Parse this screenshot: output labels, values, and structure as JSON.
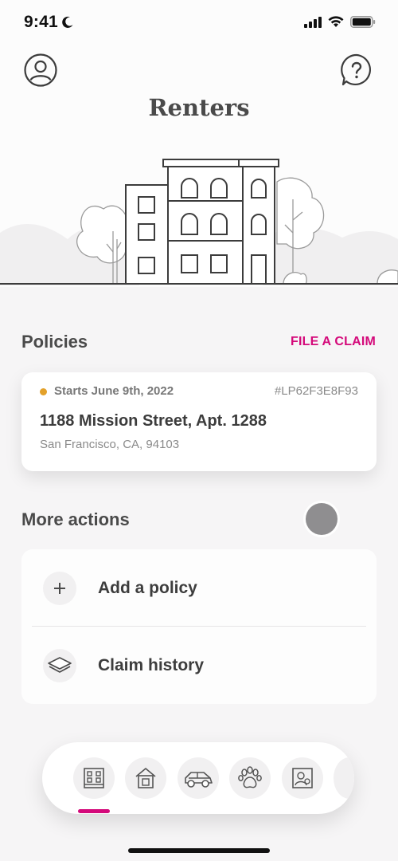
{
  "status_bar": {
    "time": "9:41"
  },
  "header": {
    "title": "Renters"
  },
  "policies": {
    "section_title": "Policies",
    "file_claim_label": "FILE A CLAIM",
    "card": {
      "status": "Starts June 9th, 2022",
      "status_color": "#e3a12a",
      "policy_number": "#LP62F3E8F93",
      "address": "1188 Mission Street, Apt. 1288",
      "city": "San Francisco, CA, 94103"
    }
  },
  "more_actions": {
    "section_title": "More actions",
    "items": [
      {
        "label": "Add a policy",
        "icon": "plus-icon"
      },
      {
        "label": "Claim history",
        "icon": "layers-icon"
      }
    ]
  },
  "bottom_nav": {
    "items": [
      {
        "icon": "apartment-icon",
        "active": true
      },
      {
        "icon": "house-icon",
        "active": false
      },
      {
        "icon": "car-icon",
        "active": false
      },
      {
        "icon": "paw-icon",
        "active": false
      },
      {
        "icon": "photo-life-icon",
        "active": false
      }
    ]
  },
  "colors": {
    "accent": "#d4097a",
    "background": "#f6f5f6",
    "text": "#3a3a3a"
  }
}
